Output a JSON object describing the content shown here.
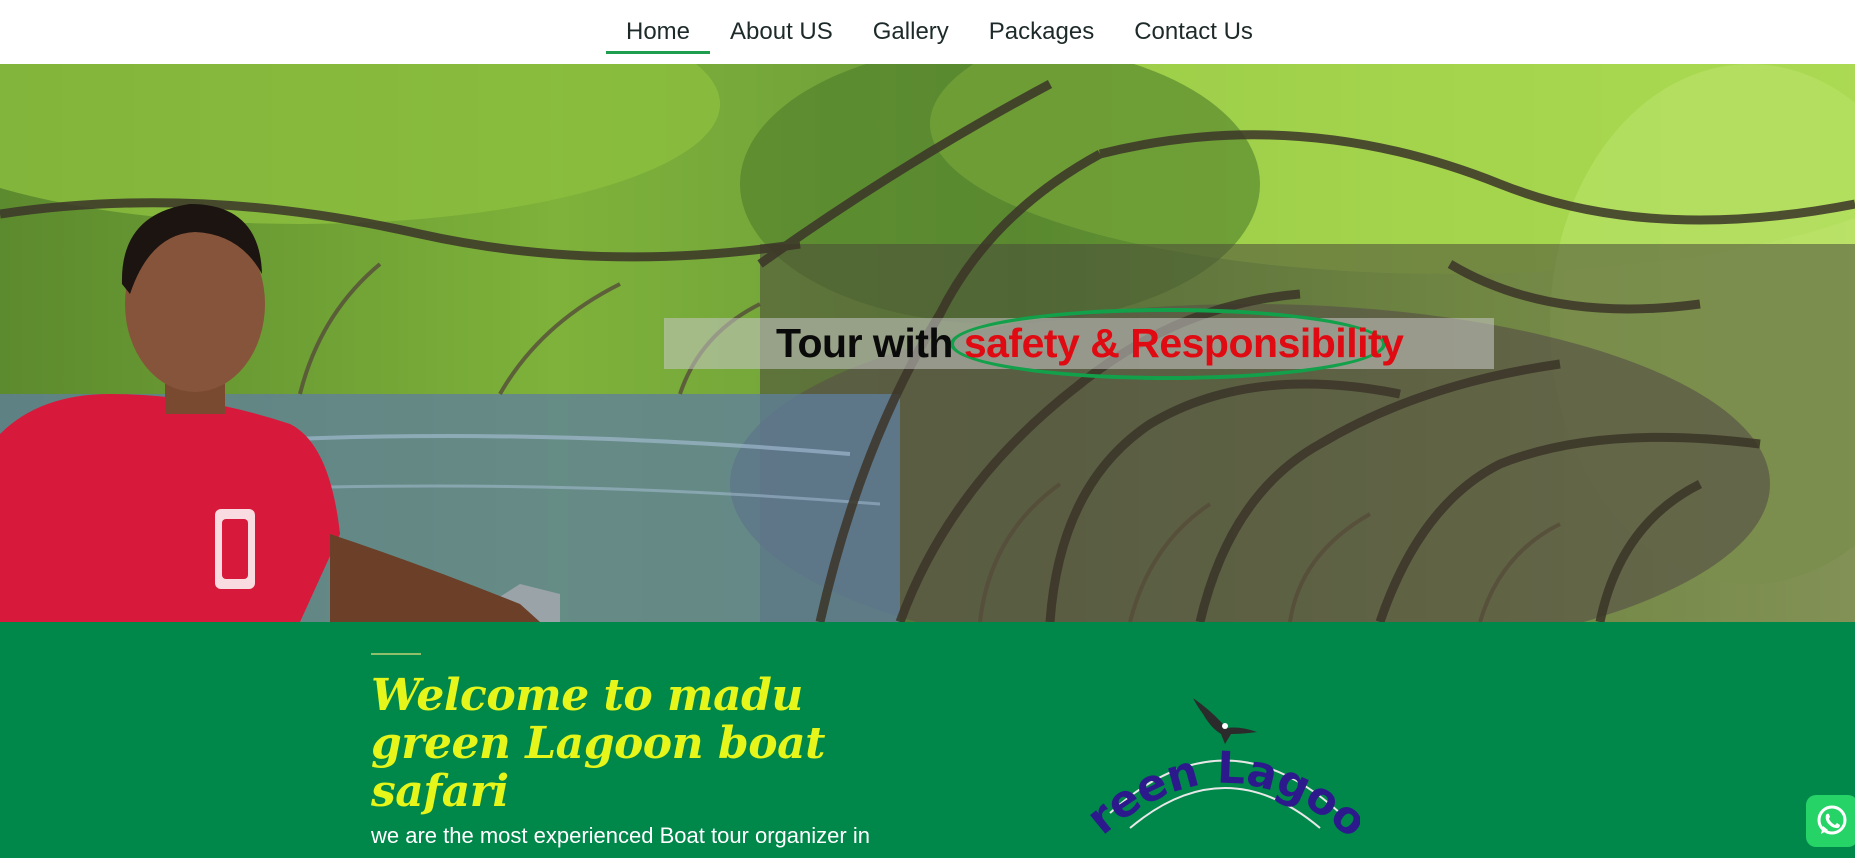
{
  "nav": {
    "items": [
      {
        "label": "Home",
        "active": true
      },
      {
        "label": "About US",
        "active": false
      },
      {
        "label": "Gallery",
        "active": false
      },
      {
        "label": "Packages",
        "active": false
      },
      {
        "label": "Contact Us",
        "active": false
      }
    ]
  },
  "hero": {
    "tagline_plain": "Tour with ",
    "tagline_accent": "safety & Responsibility"
  },
  "welcome": {
    "title": "Welcome to madu green Lagoon boat safari",
    "body": "we are the most experienced Boat tour organizer in"
  },
  "logo": {
    "text": "Green Lagoon"
  },
  "icons": {
    "whatsapp": "whatsapp-icon",
    "logo_bird": "eagle-icon"
  },
  "colors": {
    "nav_active_underline": "#1f9e4f",
    "welcome_bg": "#00874a",
    "title": "#e6f51a",
    "tagline_accent": "#e00a12",
    "oval": "#12a04a",
    "logo_text": "#2c1a8c",
    "whatsapp": "#25d366"
  }
}
